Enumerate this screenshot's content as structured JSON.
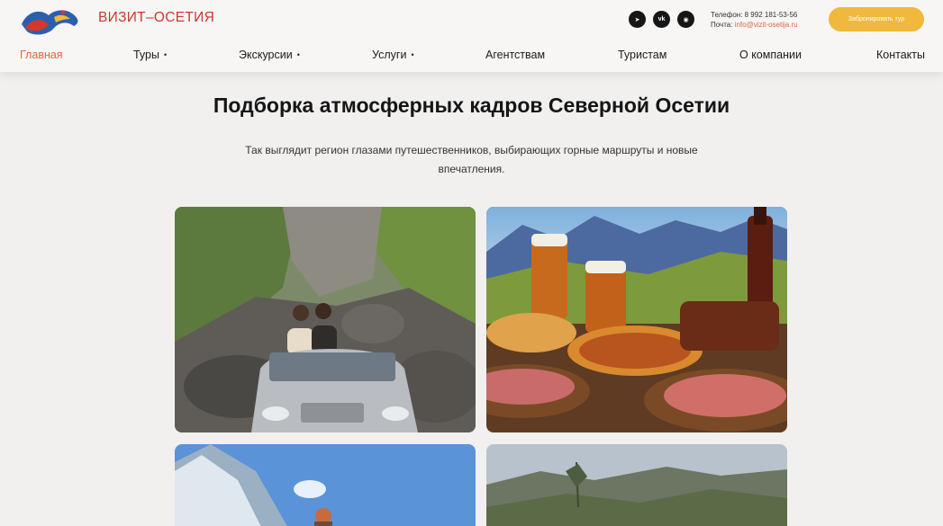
{
  "header": {
    "brand": "ВИЗИТ–ОСЕТИЯ",
    "phone": "Телефон: 8 992 181-53-56",
    "email_label": "Почта:",
    "email": "info@vizit-osetija.ru",
    "book_button": "Забронировать тур",
    "socials": [
      {
        "icon": "telegram-icon",
        "glyph": "➤"
      },
      {
        "icon": "vk-icon",
        "glyph": "vk"
      },
      {
        "icon": "max-icon",
        "glyph": "◉"
      }
    ]
  },
  "nav": {
    "items": [
      {
        "label": "Главная",
        "active": true,
        "dropdown": false
      },
      {
        "label": "Туры",
        "active": false,
        "dropdown": true
      },
      {
        "label": "Экскурсии",
        "active": false,
        "dropdown": true
      },
      {
        "label": "Услуги",
        "active": false,
        "dropdown": true
      },
      {
        "label": "Агентствам",
        "active": false,
        "dropdown": false
      },
      {
        "label": "Туристам",
        "active": false,
        "dropdown": false
      },
      {
        "label": "О компании",
        "active": false,
        "dropdown": false
      },
      {
        "label": "Контакты",
        "active": false,
        "dropdown": false
      }
    ],
    "dropdown_marker": "•"
  },
  "main": {
    "title": "Подборка атмосферных кадров Северной Осетии",
    "subtitle": "Так выглядит регион глазами путешественников, выбирающих горные маршруты и новые впечатления."
  },
  "colors": {
    "accent": "#e0673d",
    "brand": "#c8392f",
    "button": "#f0b83c",
    "background": "#f1f0ef"
  }
}
